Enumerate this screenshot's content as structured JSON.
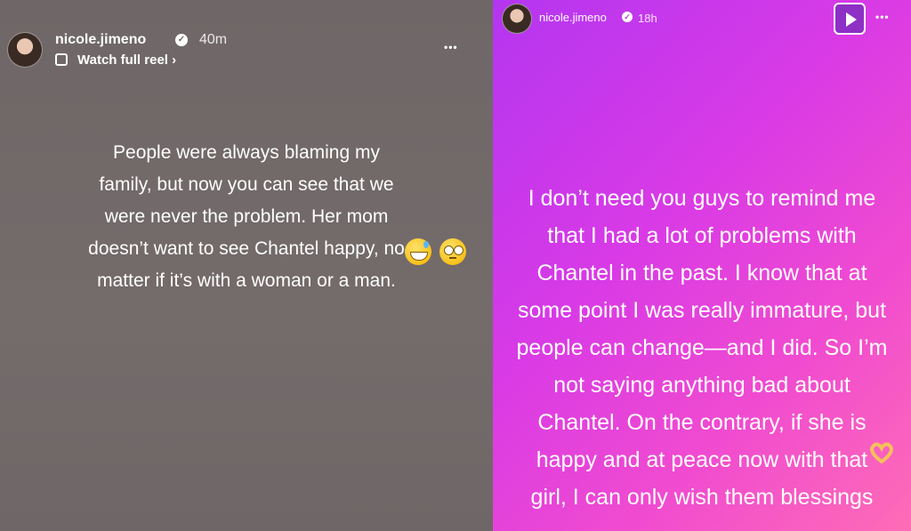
{
  "left_story": {
    "username": "nicole.jimeno",
    "time": "40m",
    "reel_link": "Watch full reel",
    "reel_chevron": "›",
    "more": "•••",
    "text": "People were always blaming my\nfamily, but now you can see that we\nwere never the problem. Her mom\ndoesn’t want to see Chantel happy, no\nmatter if it’s with a woman or a man.",
    "emojis": [
      "grinning-sweat-emoji",
      "eye-roll-emoji"
    ]
  },
  "right_story": {
    "username": "nicole.jimeno",
    "time": "18h",
    "more": "•••",
    "text": "I don’t need you guys to remind me\nthat I had a lot of problems with\nChantel in the past. I know that at\nsome point I was really immature, but\npeople can change—and I did. So I’m\nnot saying anything bad about\nChantel. On the contrary, if she is\nhappy and at peace now with that\ngirl, I can only wish them blessings",
    "emojis": [
      "heart-hands-emoji"
    ]
  },
  "colors": {
    "left_bg": "#6f6767",
    "right_gradient_start": "#b436f0",
    "right_gradient_end": "#ff6cb5"
  }
}
